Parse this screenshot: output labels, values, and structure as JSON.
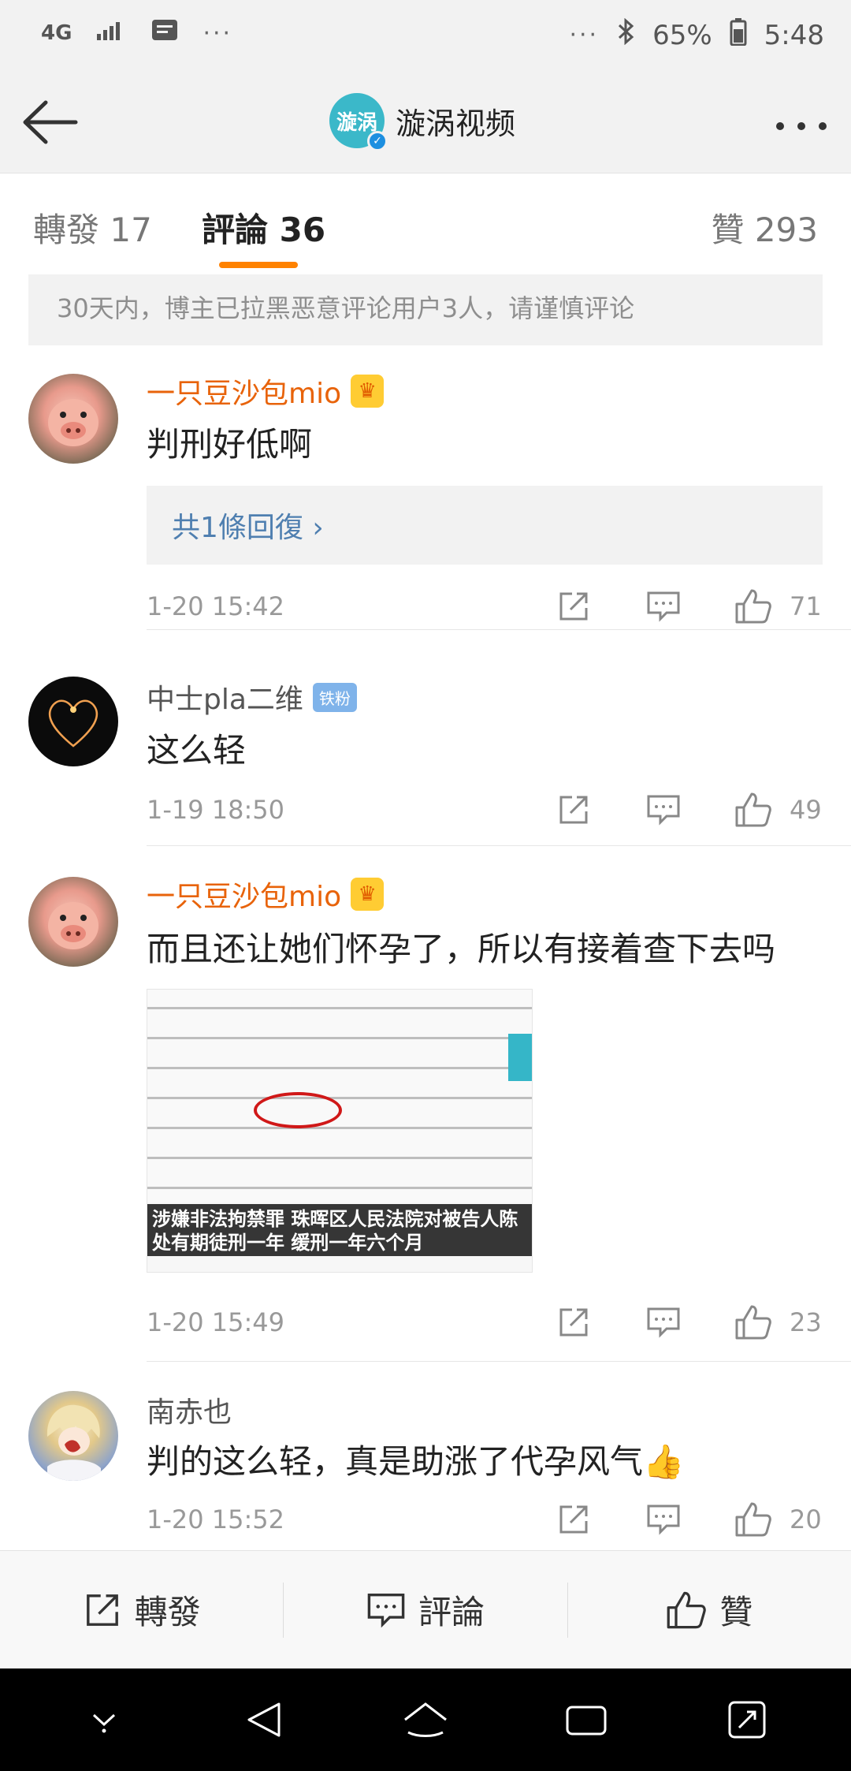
{
  "status_bar": {
    "network": "4G",
    "battery": "65%",
    "time": "5:48",
    "dots": "···"
  },
  "header": {
    "avatar_text": "漩涡",
    "title": "漩涡视频"
  },
  "tabs": {
    "repost": "轉發 17",
    "comment": "評論 36",
    "like": "贊 293"
  },
  "notice": "30天内，博主已拉黑恶意评论用户3人，请谨慎评论",
  "comments": [
    {
      "user": "一只豆沙包mio",
      "text": "判刑好低啊",
      "replies": "共1條回復 ›",
      "time": "1-20 15:42",
      "likes": "71"
    },
    {
      "user": "中士pla二维",
      "badge": "铁粉",
      "text": "这么轻",
      "time": "1-19 18:50",
      "likes": "49"
    },
    {
      "user": "一只豆沙包mio",
      "text": "而且还让她们怀孕了，所以有接着查下去吗",
      "image_caption_1": "涉嫌非法拘禁罪 珠晖区人民法院对被告人陈",
      "image_caption_2": "处有期徒刑一年 缓刑一年六个月",
      "time": "1-20 15:49",
      "likes": "23"
    },
    {
      "user": "南赤也",
      "text": "判的这么轻，真是助涨了代孕风气👍",
      "time": "1-20 15:52",
      "likes": "20"
    }
  ],
  "bottom_bar": {
    "repost": "轉發",
    "comment": "評論",
    "like": "贊"
  },
  "colors": {
    "accent": "#ff8200",
    "vip_name": "#e8630a",
    "link": "#4f7fb0"
  }
}
